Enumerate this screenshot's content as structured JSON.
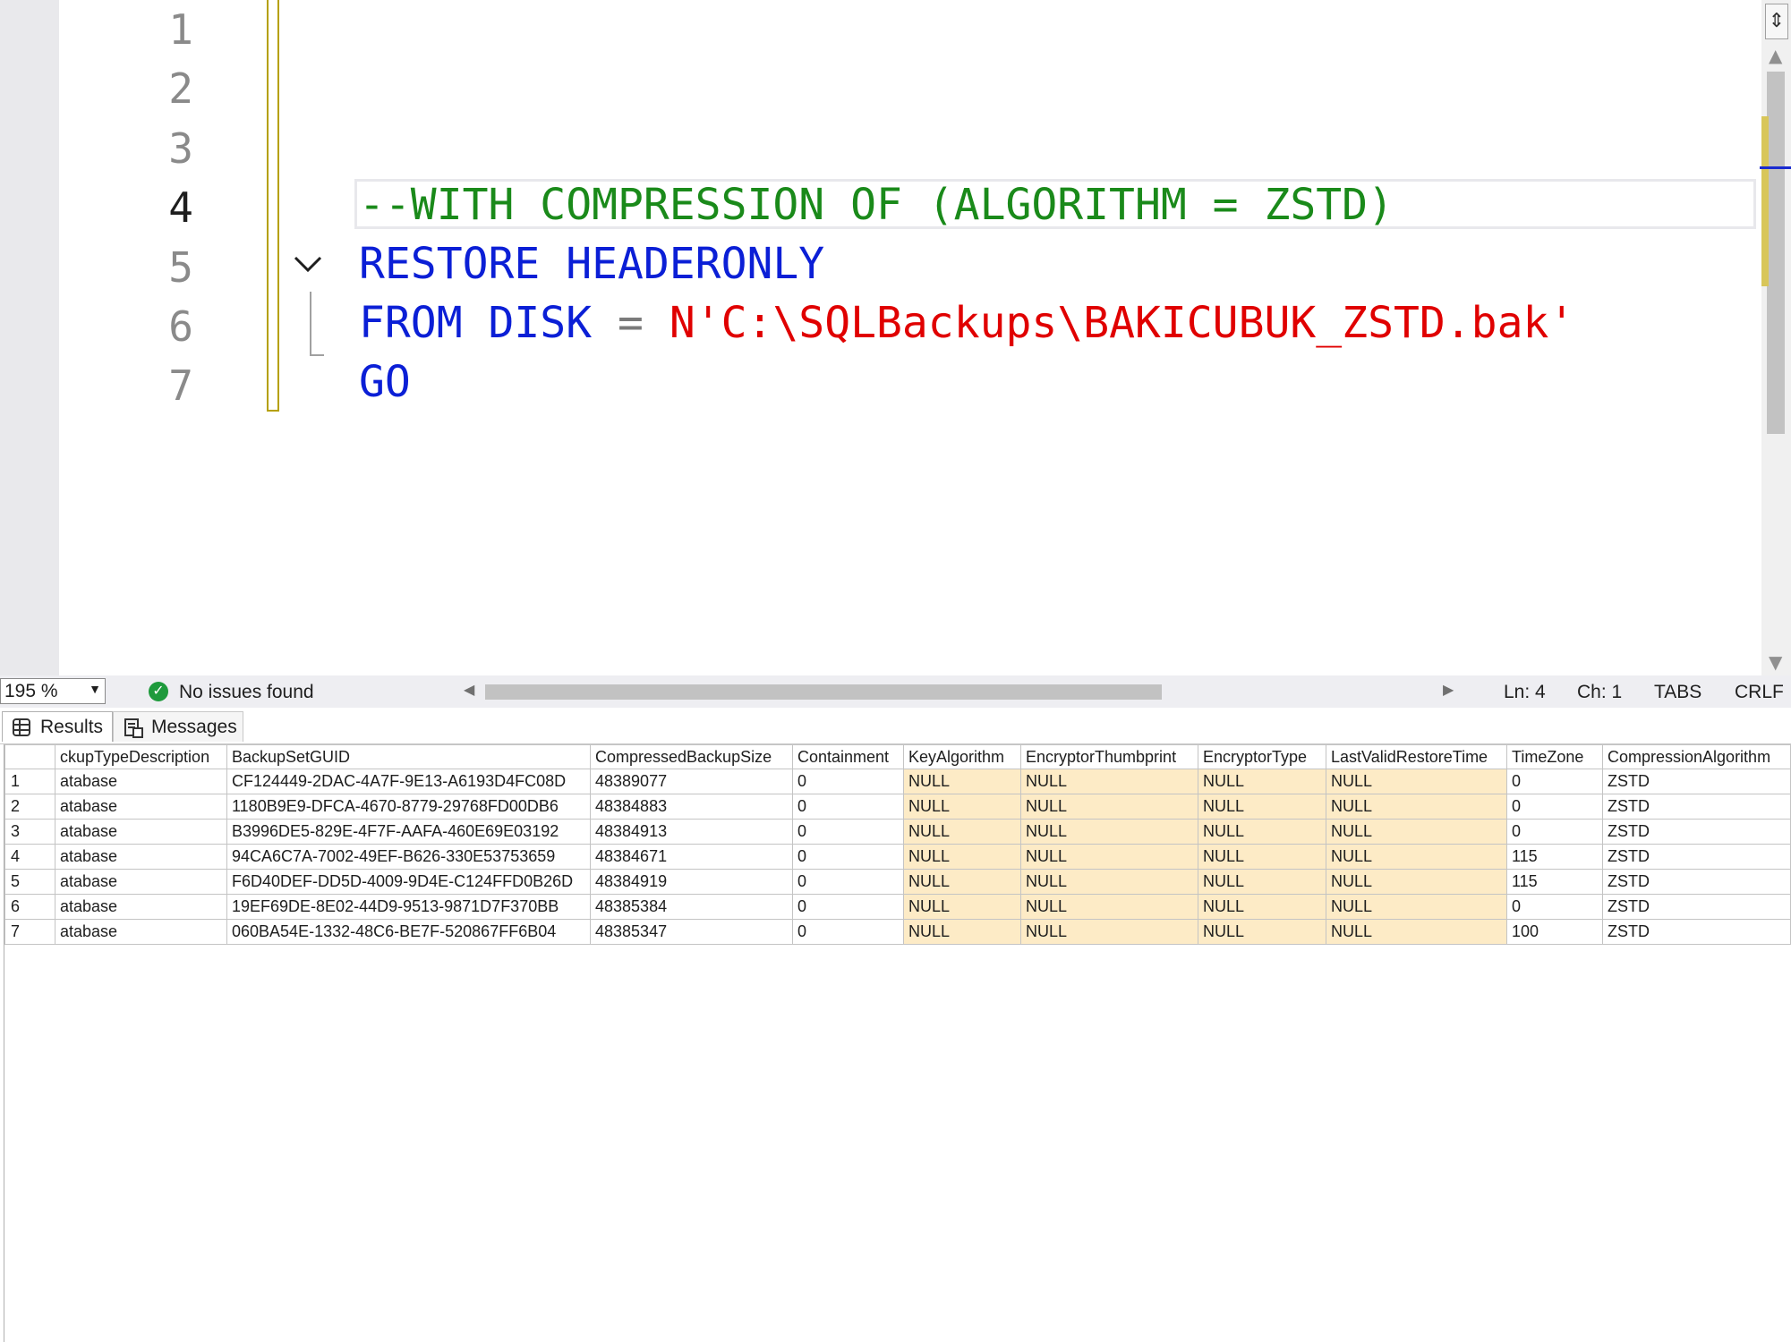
{
  "editor": {
    "line_numbers": [
      "1",
      "2",
      "3",
      "4",
      "5",
      "6",
      "7"
    ],
    "current_line": 4,
    "lines": {
      "l4": "--WITH COMPRESSION OF (ALGORITHM = ZSTD)",
      "l5": "RESTORE HEADERONLY",
      "l6_kw": "FROM DISK",
      "l6_op": "=",
      "l6_str": "N'C:\\SQLBackups\\BAKICUBUK_ZSTD.bak'",
      "l7": "GO"
    }
  },
  "colors": {
    "keyword": "#0b1fd6",
    "comment": "#1a8a1a",
    "string": "#e00000",
    "null_cell": "#fdebc6"
  },
  "statusbar": {
    "zoom": "195 %",
    "issues": "No issues found",
    "ln": "Ln: 4",
    "ch": "Ch: 1",
    "indent": "TABS",
    "eol": "CRLF"
  },
  "tabs": {
    "results": "Results",
    "messages": "Messages"
  },
  "grid": {
    "columns": [
      "ckupTypeDescription",
      "BackupSetGUID",
      "CompressedBackupSize",
      "Containment",
      "KeyAlgorithm",
      "EncryptorThumbprint",
      "EncryptorType",
      "LastValidRestoreTime",
      "TimeZone",
      "CompressionAlgorithm"
    ],
    "rows": [
      {
        "n": "1",
        "desc": "atabase",
        "guid": "CF124449-2DAC-4A7F-9E13-A6193D4FC08D",
        "size": "48389077",
        "cont": "0",
        "ka": "NULL",
        "et": "NULL",
        "etype": "NULL",
        "lvrt": "NULL",
        "tz": "0",
        "alg": "ZSTD"
      },
      {
        "n": "2",
        "desc": "atabase",
        "guid": "1180B9E9-DFCA-4670-8779-29768FD00DB6",
        "size": "48384883",
        "cont": "0",
        "ka": "NULL",
        "et": "NULL",
        "etype": "NULL",
        "lvrt": "NULL",
        "tz": "0",
        "alg": "ZSTD"
      },
      {
        "n": "3",
        "desc": "atabase",
        "guid": "B3996DE5-829E-4F7F-AAFA-460E69E03192",
        "size": "48384913",
        "cont": "0",
        "ka": "NULL",
        "et": "NULL",
        "etype": "NULL",
        "lvrt": "NULL",
        "tz": "0",
        "alg": "ZSTD"
      },
      {
        "n": "4",
        "desc": "atabase",
        "guid": "94CA6C7A-7002-49EF-B626-330E53753659",
        "size": "48384671",
        "cont": "0",
        "ka": "NULL",
        "et": "NULL",
        "etype": "NULL",
        "lvrt": "NULL",
        "tz": "115",
        "alg": "ZSTD"
      },
      {
        "n": "5",
        "desc": "atabase",
        "guid": "F6D40DEF-DD5D-4009-9D4E-C124FFD0B26D",
        "size": "48384919",
        "cont": "0",
        "ka": "NULL",
        "et": "NULL",
        "etype": "NULL",
        "lvrt": "NULL",
        "tz": "115",
        "alg": "ZSTD"
      },
      {
        "n": "6",
        "desc": "atabase",
        "guid": "19EF69DE-8E02-44D9-9513-9871D7F370BB",
        "size": "48385384",
        "cont": "0",
        "ka": "NULL",
        "et": "NULL",
        "etype": "NULL",
        "lvrt": "NULL",
        "tz": "0",
        "alg": "ZSTD"
      },
      {
        "n": "7",
        "desc": "atabase",
        "guid": "060BA54E-1332-48C6-BE7F-520867FF6B04",
        "size": "48385347",
        "cont": "0",
        "ka": "NULL",
        "et": "NULL",
        "etype": "NULL",
        "lvrt": "NULL",
        "tz": "100",
        "alg": "ZSTD"
      }
    ]
  }
}
